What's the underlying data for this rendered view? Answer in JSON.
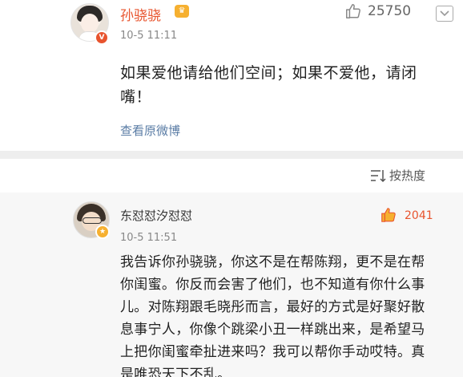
{
  "post": {
    "username": "孙骁骁",
    "timestamp": "10-5 11:11",
    "like_count": "25750",
    "text": "如果爱他请给他们空间；如果不爱他，请闭嘴！",
    "view_original_label": "查看原微博"
  },
  "sort": {
    "label": "按热度"
  },
  "comment": {
    "username": "东怼怼汐怼怼",
    "timestamp": "10-5 11:51",
    "like_count": "2041",
    "text": "我告诉你孙骁骁，你这不是在帮陈翔，更不是在帮你闺蜜。你反而会害了他们，也不知道有你什么事儿。对陈翔跟毛晓彤而言，最好的方式是好聚好散息事宁人，你像个跳梁小丑一样跳出来，是希望马上把你闺蜜牵扯进来吗？我可以帮你手动哎特。真是唯恐天下不乱。"
  },
  "colors": {
    "accent_orange": "#e8542e",
    "link_blue": "#5a7ca5",
    "vip_gold": "#f6b030"
  },
  "icons": {
    "like": "thumbs-up-icon",
    "chevron": "chevron-down-icon",
    "sort": "sort-icon",
    "verified": "verified-badge-icon",
    "vip": "vip-crown-icon"
  }
}
